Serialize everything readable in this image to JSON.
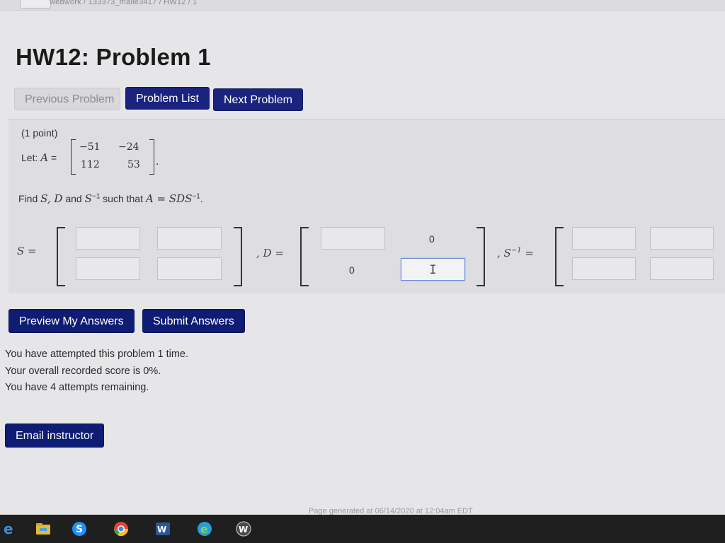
{
  "window": {
    "breadcrumb": "webwork / 133373_malle3417 / HW12 / 1"
  },
  "page": {
    "title": "HW12: Problem 1"
  },
  "nav": {
    "previous": "Previous Problem",
    "list": "Problem List",
    "next": "Next Problem"
  },
  "problem": {
    "points": "(1 point)",
    "let_prefix": "Let: ",
    "matrix_var": "A",
    "equals": " =",
    "matrix_A": [
      [
        "−51",
        "−24"
      ],
      [
        "112",
        "53"
      ]
    ],
    "period": ".",
    "find_text": "Find ",
    "find_vars": "S, D",
    "find_and": " and ",
    "find_s": "S",
    "find_inv": "−1",
    "find_such": " such that ",
    "find_eq": "A = SDS",
    "find_end": "."
  },
  "answer": {
    "s_label": "S =",
    "d_label": ", D =",
    "sinv_label": ", S",
    "sinv_sup": "−1",
    "sinv_eq": " =",
    "d_zero_top": "0",
    "d_zero_bottom": "0"
  },
  "actions": {
    "preview": "Preview My Answers",
    "submit": "Submit Answers"
  },
  "status": {
    "attempts": "You have attempted this problem 1 time.",
    "score": "Your overall recorded score is 0%.",
    "remaining": "You have 4 attempts remaining."
  },
  "email": {
    "label": "Email instructor"
  },
  "footer": {
    "generated": "Page generated at 06/14/2020 at 12:04am EDT"
  },
  "taskbar_icons": [
    "edge-icon",
    "file-explorer-icon",
    "skype-icon",
    "chrome-icon",
    "word-icon",
    "ie-icon",
    "webwork-icon"
  ],
  "colors": {
    "primary": "#1a237e",
    "panel": "#dedee1",
    "page": "#e6e6e9",
    "taskbar": "#1f1f1f"
  }
}
